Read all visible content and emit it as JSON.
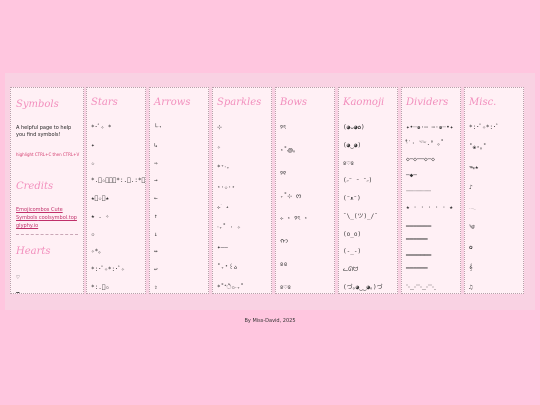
{
  "sidebar": {
    "symbols_title": "Symbols",
    "intro": "A helpful page to help you find symbols!",
    "note": "highlight CTRL+C then CTRL+V",
    "credits_title": "Credits",
    "links": [
      "Emojicombos",
      "Cute Symbols",
      "coolsymbol.top",
      "glyphy.io"
    ],
    "hearts_title": "Hearts",
    "hearts": [
      "♡",
      "❤"
    ]
  },
  "columns": [
    {
      "title": "Stars",
      "items": [
        "*･ﾟ✧ *",
        "✦",
        "☆",
        "*.ﾟ☆゜ﾟ･*:.｡.:*･ﾟ",
        "★ﾟ☆。★",
        "★ . ✧",
        "✩",
        "✧*。",
        "*:･ﾟ✧*:･ﾟ✧",
        "*:.ﾟ✩"
      ]
    },
    {
      "title": "Arrows",
      "items": [
        "└➝",
        "↳",
        "⇒",
        "→",
        "←",
        "↑",
        "↓",
        "↔",
        "↩",
        "⇪"
      ]
    },
    {
      "title": "Sparkles",
      "items": [
        "⊹",
        "✧",
        "*⁺‧₊",
        "⋆⋅☆⋅⋆",
        "⊹ ࣪ ˖",
        "‧₊˚ ⋅ ✧",
        "✦——",
        "˚₊‧꒰ა",
        "*˚*ੈ✩‧₊˚"
      ]
    },
    {
      "title": "Bows",
      "items": [
        "୨ৎ",
        "⋆˚꩜｡",
        "୨୧",
        "₊˚⊹ ᰔ",
        "⊹ ⋆ ୨ৎ ⋆",
        "ᡣ𐭩",
        "ʚɞ",
        "ʚ♡ɞ"
      ]
    },
    {
      "title": "Kaomoji",
      "items": [
        "(◕ᴗ◕✿)",
        "(◕‿◕)",
        "ʚ♡ɞ",
        "(˶ᵔ ᵕ ᵔ˶)",
        "(ᵔᴥᵔ)",
        "¯\\_(ツ)_/¯",
        "(o_o)",
        "(-_-)",
        "ᓚᘏᗢ",
        "(づ｡◕‿‿◕｡)づ"
      ]
    },
    {
      "title": "Dividers",
      "items": [
        "✦•┈๑⋅⋯ ⋯⋅๑┈•✦",
        "‧̍̊˙· 𓆝.° ｡˚",
        "◇─◇──◇─◇",
        "─◆─",
        "┈┈┈┈┈┈┈",
        "★ · · · · · ★",
        "▁▁▁▁▁▁▁",
        "━━━━━━",
        "═══════",
        "▔▔▔▔▔▔",
        "⋱⋰⋱⋰⋱"
      ]
    },
    {
      "title": "Misc.",
      "items": [
        "*:･ﾟ✧*:･ﾟ",
        "˚❀⋆｡˚",
        "ᯓ★",
        "♪",
        "𓂃",
        "༄",
        "✿",
        "𝄞",
        "♫"
      ]
    }
  ],
  "footer": "By Miss-David, 2025"
}
